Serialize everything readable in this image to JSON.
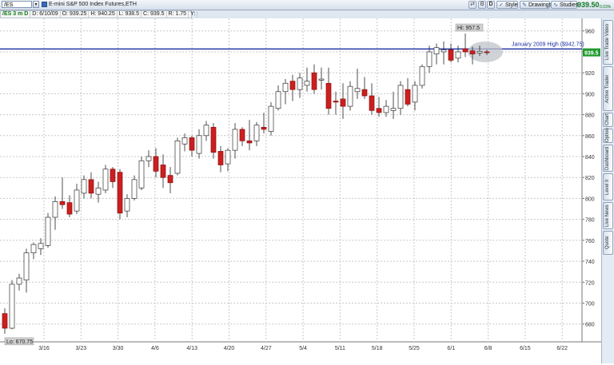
{
  "toolbar": {
    "symbol_input": "/ES",
    "description": "E-mini S&P 500 Index Futures,ETH",
    "d_button": "D",
    "style_label": "Style",
    "drawings_label": "Drawings",
    "studies_label": "Studies",
    "last_price": "939.50",
    "change": "0.03%"
  },
  "infobar": {
    "symbol": "/ES 3 m D",
    "date": "D: 6/10/09",
    "open": "O: 939.25",
    "high": "H: 940.25",
    "low": "L: 938.5",
    "close": "C: 939.5",
    "range": "R: 1.75",
    "y": "Y:"
  },
  "annotations": {
    "hi_label": "Hi: 957.5",
    "lo_label": "Lo: 670.75",
    "level_label": "January 2009 High ($942.75)",
    "price_tag": "939.5"
  },
  "side_tabs": [
    "Live Trade Video",
    "Active Trader",
    "Chart",
    "Option",
    "Dashboard",
    "Level II",
    "Live News",
    "Quote"
  ],
  "colors": {
    "up": "#ffffff",
    "down": "#cc1f1f",
    "level": "#1c2fa3",
    "grid": "#c8c8c8"
  },
  "chart_data": {
    "type": "candlestick",
    "x_labels": [
      "3/16",
      "3/23",
      "3/30",
      "4/6",
      "4/13",
      "4/20",
      "4/27",
      "5/4",
      "5/11",
      "5/18",
      "5/25",
      "6/1",
      "6/8",
      "6/15",
      "6/22"
    ],
    "y_ticks": [
      680,
      700,
      720,
      740,
      760,
      780,
      800,
      820,
      840,
      860,
      880,
      900,
      920,
      940,
      960
    ],
    "ylim": [
      663,
      972
    ],
    "level_line": 942.75,
    "hi": 957.5,
    "lo": 670.75,
    "candles": [
      {
        "o": 690,
        "h": 695,
        "l": 670.75,
        "c": 676
      },
      {
        "o": 676,
        "h": 722,
        "l": 675,
        "c": 718
      },
      {
        "o": 718,
        "h": 728,
        "l": 712,
        "c": 724
      },
      {
        "o": 722,
        "h": 752,
        "l": 710,
        "c": 748
      },
      {
        "o": 748,
        "h": 758,
        "l": 742,
        "c": 756
      },
      {
        "o": 752,
        "h": 762,
        "l": 746,
        "c": 757
      },
      {
        "o": 755,
        "h": 786,
        "l": 753,
        "c": 782
      },
      {
        "o": 782,
        "h": 802,
        "l": 770,
        "c": 797
      },
      {
        "o": 797,
        "h": 820,
        "l": 790,
        "c": 794
      },
      {
        "o": 796,
        "h": 803,
        "l": 782,
        "c": 785
      },
      {
        "o": 788,
        "h": 814,
        "l": 785,
        "c": 808
      },
      {
        "o": 805,
        "h": 822,
        "l": 800,
        "c": 818
      },
      {
        "o": 818,
        "h": 825,
        "l": 800,
        "c": 805
      },
      {
        "o": 804,
        "h": 816,
        "l": 796,
        "c": 810
      },
      {
        "o": 808,
        "h": 832,
        "l": 805,
        "c": 828
      },
      {
        "o": 828,
        "h": 830,
        "l": 810,
        "c": 816
      },
      {
        "o": 825,
        "h": 828,
        "l": 780,
        "c": 786
      },
      {
        "o": 788,
        "h": 804,
        "l": 782,
        "c": 800
      },
      {
        "o": 800,
        "h": 822,
        "l": 798,
        "c": 818
      },
      {
        "o": 810,
        "h": 840,
        "l": 808,
        "c": 836
      },
      {
        "o": 836,
        "h": 846,
        "l": 830,
        "c": 840
      },
      {
        "o": 840,
        "h": 848,
        "l": 820,
        "c": 826
      },
      {
        "o": 832,
        "h": 842,
        "l": 810,
        "c": 820
      },
      {
        "o": 822,
        "h": 830,
        "l": 805,
        "c": 815
      },
      {
        "o": 824,
        "h": 858,
        "l": 822,
        "c": 855
      },
      {
        "o": 852,
        "h": 862,
        "l": 845,
        "c": 858
      },
      {
        "o": 858,
        "h": 860,
        "l": 840,
        "c": 846
      },
      {
        "o": 843,
        "h": 866,
        "l": 838,
        "c": 860
      },
      {
        "o": 860,
        "h": 874,
        "l": 855,
        "c": 870
      },
      {
        "o": 868,
        "h": 872,
        "l": 838,
        "c": 844
      },
      {
        "o": 845,
        "h": 850,
        "l": 825,
        "c": 832
      },
      {
        "o": 833,
        "h": 848,
        "l": 826,
        "c": 846
      },
      {
        "o": 846,
        "h": 872,
        "l": 838,
        "c": 866
      },
      {
        "o": 866,
        "h": 868,
        "l": 850,
        "c": 855
      },
      {
        "o": 855,
        "h": 875,
        "l": 846,
        "c": 853
      },
      {
        "o": 855,
        "h": 873,
        "l": 850,
        "c": 870
      },
      {
        "o": 868,
        "h": 882,
        "l": 862,
        "c": 866
      },
      {
        "o": 864,
        "h": 892,
        "l": 860,
        "c": 888
      },
      {
        "o": 886,
        "h": 908,
        "l": 884,
        "c": 902
      },
      {
        "o": 902,
        "h": 914,
        "l": 890,
        "c": 910
      },
      {
        "o": 912,
        "h": 918,
        "l": 893,
        "c": 904
      },
      {
        "o": 904,
        "h": 920,
        "l": 896,
        "c": 915
      },
      {
        "o": 908,
        "h": 925,
        "l": 902,
        "c": 912
      },
      {
        "o": 920,
        "h": 928,
        "l": 900,
        "c": 904
      },
      {
        "o": 913,
        "h": 925,
        "l": 904,
        "c": 914
      },
      {
        "o": 910,
        "h": 925,
        "l": 880,
        "c": 886
      },
      {
        "o": 893,
        "h": 902,
        "l": 880,
        "c": 892
      },
      {
        "o": 895,
        "h": 910,
        "l": 876,
        "c": 888
      },
      {
        "o": 888,
        "h": 912,
        "l": 884,
        "c": 907
      },
      {
        "o": 902,
        "h": 924,
        "l": 895,
        "c": 905
      },
      {
        "o": 904,
        "h": 916,
        "l": 895,
        "c": 898
      },
      {
        "o": 898,
        "h": 910,
        "l": 880,
        "c": 884
      },
      {
        "o": 886,
        "h": 897,
        "l": 878,
        "c": 882
      },
      {
        "o": 882,
        "h": 894,
        "l": 878,
        "c": 888
      },
      {
        "o": 884,
        "h": 902,
        "l": 876,
        "c": 886
      },
      {
        "o": 886,
        "h": 912,
        "l": 880,
        "c": 908
      },
      {
        "o": 904,
        "h": 915,
        "l": 888,
        "c": 890
      },
      {
        "o": 892,
        "h": 912,
        "l": 884,
        "c": 908
      },
      {
        "o": 908,
        "h": 928,
        "l": 905,
        "c": 926
      },
      {
        "o": 926,
        "h": 946,
        "l": 920,
        "c": 940
      },
      {
        "o": 938,
        "h": 948,
        "l": 928,
        "c": 944
      },
      {
        "o": 940,
        "h": 950,
        "l": 928,
        "c": 942
      },
      {
        "o": 942,
        "h": 948,
        "l": 930,
        "c": 932
      },
      {
        "o": 934,
        "h": 946,
        "l": 930,
        "c": 940
      },
      {
        "o": 943,
        "h": 957.5,
        "l": 935,
        "c": 940
      },
      {
        "o": 941,
        "h": 945,
        "l": 928,
        "c": 938
      },
      {
        "o": 939,
        "h": 946,
        "l": 936,
        "c": 940.5
      },
      {
        "o": 940,
        "h": 942,
        "l": 937,
        "c": 939.5
      }
    ]
  }
}
